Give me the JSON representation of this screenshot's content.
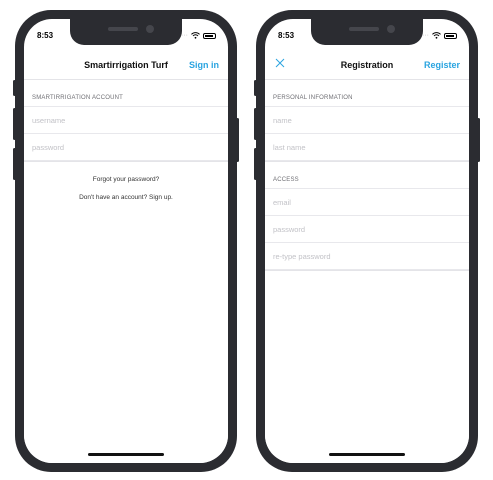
{
  "login_screen": {
    "status_time": "8:53",
    "title": "Smartirrigation Turf",
    "sign_in_label": "Sign in",
    "section_header": "SMARTIRRIGATION ACCOUNT",
    "username_placeholder": "username",
    "password_placeholder": "password",
    "forgot_password": "Forgot your password?",
    "sign_up_prompt": "Don't have an account? Sign up."
  },
  "registration_screen": {
    "status_time": "8:53",
    "title": "Registration",
    "register_label": "Register",
    "close_icon": "close-icon",
    "personal_section_header": "PERSONAL INFORMATION",
    "name_placeholder": "name",
    "last_name_placeholder": "last name",
    "access_section_header": "ACCESS",
    "email_placeholder": "email",
    "password_placeholder": "password",
    "retype_password_placeholder": "re-type password"
  },
  "colors": {
    "accent": "#2aa4e0",
    "phone_frame": "#2b2c31",
    "placeholder": "#c2c2c7"
  }
}
